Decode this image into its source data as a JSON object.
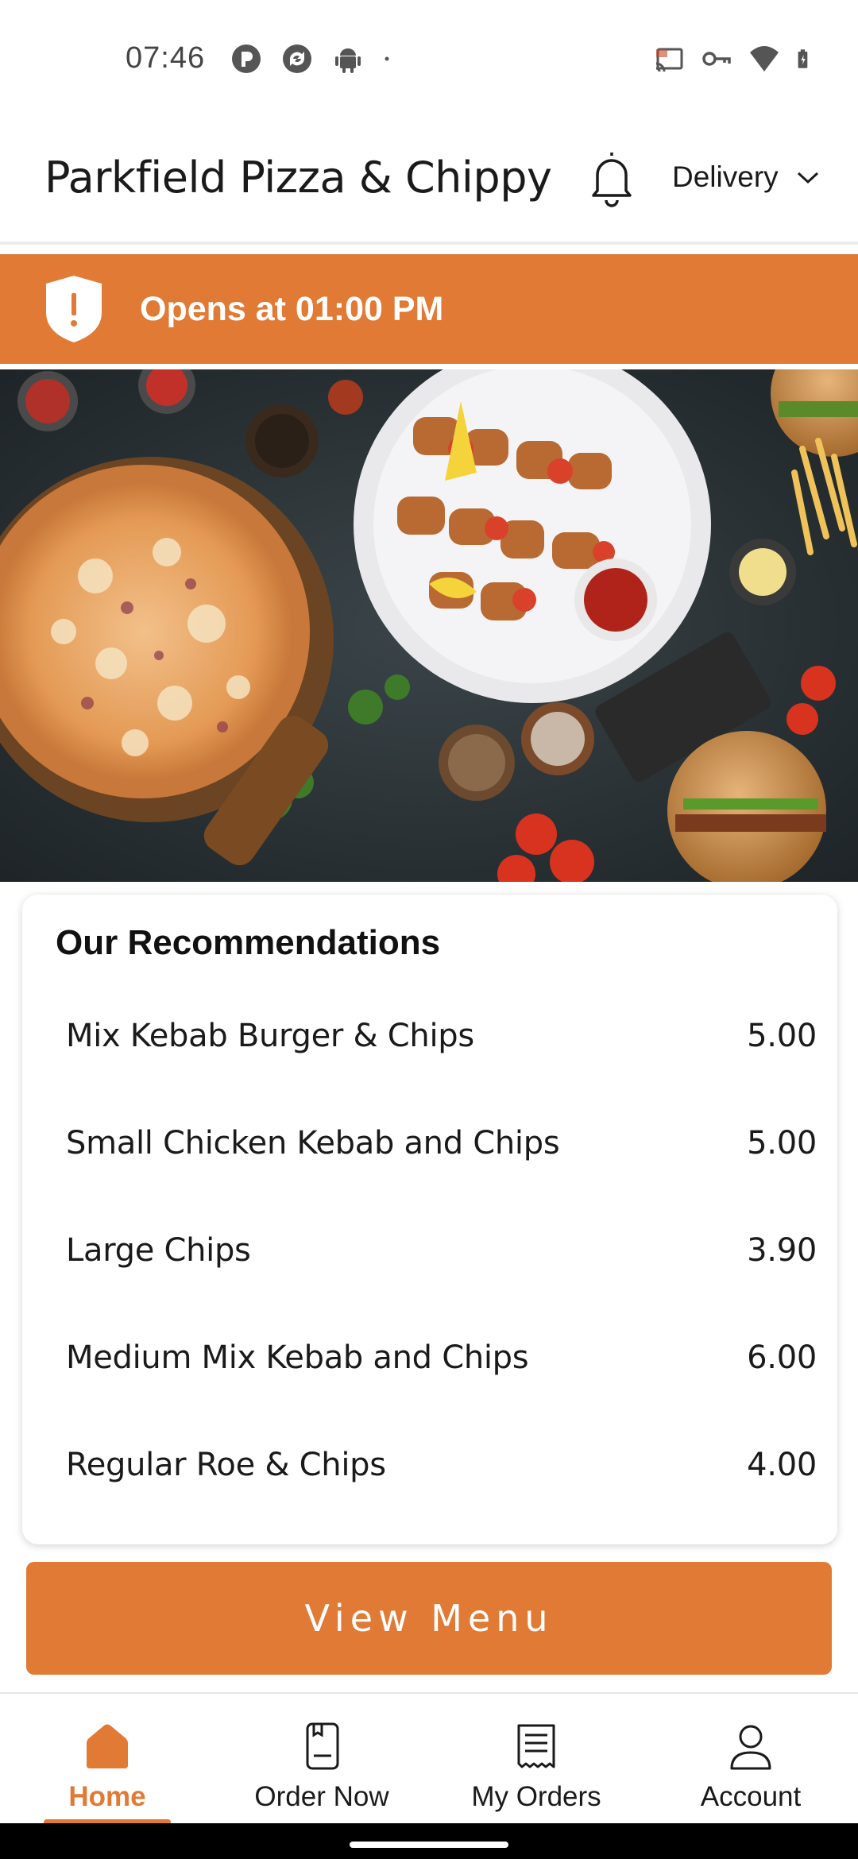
{
  "status_bar": {
    "time": "07:46",
    "left_icons": [
      "app-notification-icon",
      "sync-icon",
      "android-icon",
      "dot-icon"
    ],
    "right_icons": [
      "cast-icon",
      "vpn-key-icon",
      "wifi-icon",
      "battery-icon"
    ]
  },
  "header": {
    "store_name": "Parkfield Pizza & Chippy",
    "notification_icon": "bell-icon",
    "order_type": "Delivery"
  },
  "banner": {
    "text": "Opens at 01:00 PM",
    "icon": "shield-alert-icon",
    "color": "#e07a35"
  },
  "recommendations": {
    "title": "Our Recommendations",
    "items": [
      {
        "name": "Mix Kebab Burger & Chips",
        "price": "5.00"
      },
      {
        "name": "Small Chicken Kebab and Chips",
        "price": "5.00"
      },
      {
        "name": "Large Chips",
        "price": "3.90"
      },
      {
        "name": "Medium Mix Kebab and Chips",
        "price": "6.00"
      },
      {
        "name": "Regular Roe & Chips",
        "price": "4.00"
      }
    ]
  },
  "view_menu_label": "View Menu",
  "bottom_nav": {
    "items": [
      {
        "label": "Home",
        "icon": "home-icon",
        "active": true
      },
      {
        "label": "Order Now",
        "icon": "order-now-icon",
        "active": false
      },
      {
        "label": "My Orders",
        "icon": "receipt-icon",
        "active": false
      },
      {
        "label": "Account",
        "icon": "user-icon",
        "active": false
      }
    ]
  },
  "colors": {
    "accent": "#e07a35",
    "text": "#1a1a1a"
  }
}
